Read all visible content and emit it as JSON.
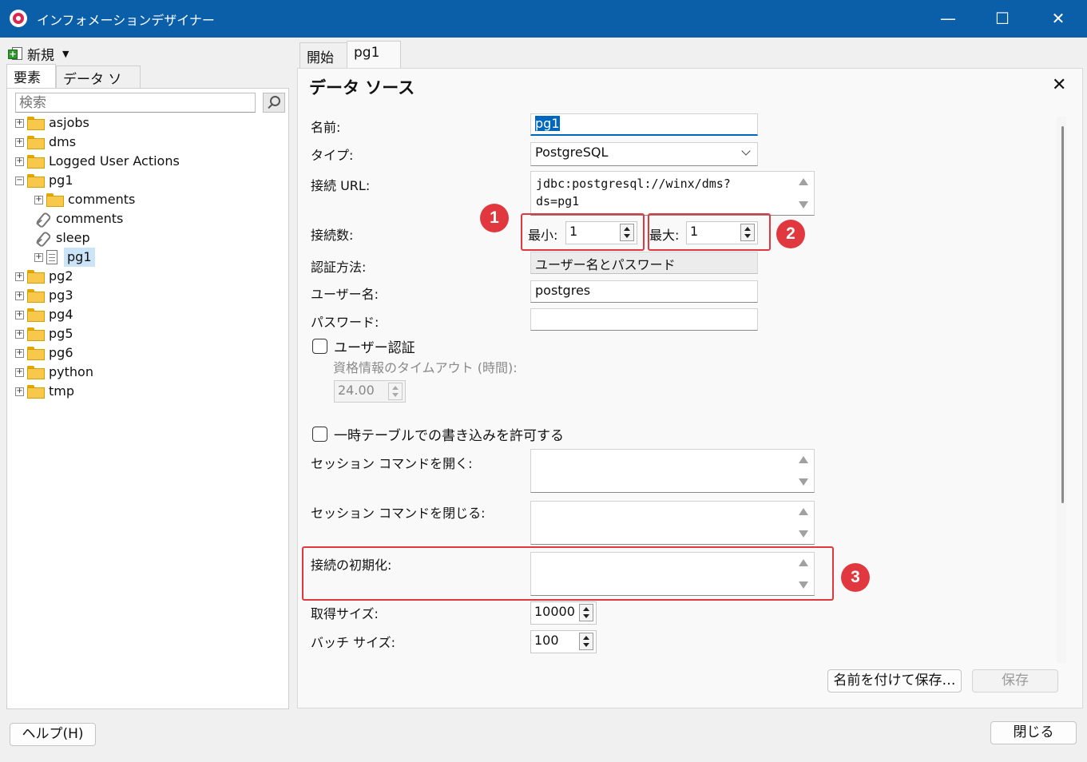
{
  "window": {
    "title": "インフォメーションデザイナー",
    "minimize": "—",
    "maximize": "☐",
    "close": "✕"
  },
  "left": {
    "new_label": "新規",
    "tabs": [
      "要素",
      "データ ソース"
    ],
    "search_placeholder": "検索",
    "tree": [
      {
        "label": "asjobs"
      },
      {
        "label": "dms"
      },
      {
        "label": "Logged User Actions"
      },
      {
        "label": "pg1"
      },
      {
        "label": "comments"
      },
      {
        "label": "comments"
      },
      {
        "label": "sleep"
      },
      {
        "label": "pg1"
      },
      {
        "label": "pg2"
      },
      {
        "label": "pg3"
      },
      {
        "label": "pg4"
      },
      {
        "label": "pg5"
      },
      {
        "label": "pg6"
      },
      {
        "label": "python"
      },
      {
        "label": "tmp"
      }
    ]
  },
  "right": {
    "tabs": [
      "開始",
      "pg1"
    ],
    "title": "データ ソース",
    "close": "✕",
    "form": {
      "name_label": "名前:",
      "name_value": "pg1",
      "type_label": "タイプ:",
      "type_value": "PostgreSQL",
      "url_label": "接続 URL:",
      "url_value": "jdbc:postgresql://winx/dms?\nds=pg1",
      "connections_label": "接続数:",
      "min_label": "最小:",
      "min_value": "1",
      "max_label": "最大:",
      "max_value": "1",
      "auth_label": "認証方法:",
      "auth_value": "ユーザー名とパスワード",
      "user_label": "ユーザー名:",
      "user_value": "postgres",
      "password_label": "パスワード:",
      "password_value": "",
      "user_auth_label": "ユーザー認証",
      "cred_timeout_label": "資格情報のタイムアウト (時間):",
      "cred_timeout_value": "24.00",
      "temp_table_label": "一時テーブルでの書き込みを許可する",
      "open_cmd_label": "セッション コマンドを開く:",
      "close_cmd_label": "セッション コマンドを閉じる:",
      "init_label": "接続の初期化:",
      "fetch_label": "取得サイズ:",
      "fetch_value": "10000",
      "batch_label": "バッチ サイズ:",
      "batch_value": "100"
    },
    "save_as": "名前を付けて保存…",
    "save": "保存"
  },
  "annotations": [
    "1",
    "2",
    "3"
  ],
  "footer": {
    "help": "ヘルプ(H)",
    "close": "閉じる"
  },
  "colors": {
    "titlebar": "#0b5fa8",
    "highlight": "#e0383e",
    "selection": "#0067c0"
  }
}
